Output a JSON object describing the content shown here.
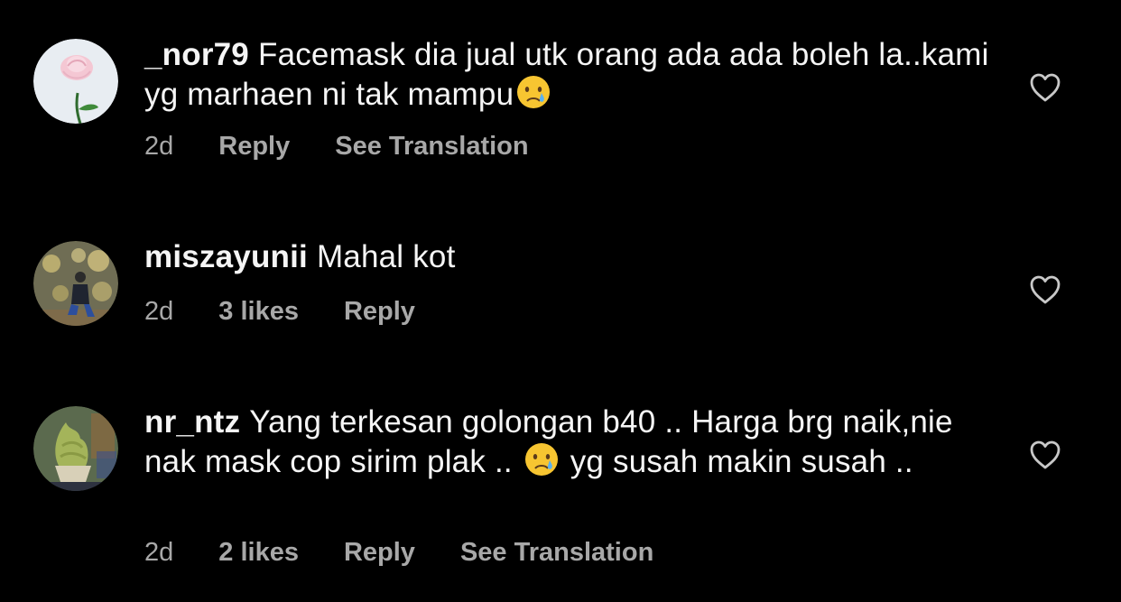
{
  "comments": [
    {
      "username": "_nor79",
      "text_parts": [
        "Facemask dia jual utk orang ada ada boleh la..kami yg marhaen ni tak mampu"
      ],
      "time": "2d",
      "likes": "",
      "reply": "Reply",
      "translate": "See Translation",
      "avatar_icon": "rose-avatar",
      "emoji": "crying-face"
    },
    {
      "username": "miszayunii",
      "text_parts": [
        "Mahal kot"
      ],
      "time": "2d",
      "likes": "3 likes",
      "reply": "Reply",
      "translate": "",
      "avatar_icon": "person-lights-avatar"
    },
    {
      "username": "nr_ntz",
      "text_parts": [
        "Yang terkesan golongan b40 .. Harga brg naik,nie nak mask cop sirim plak ..",
        "yg susah makin susah .."
      ],
      "time": "2d",
      "likes": "2 likes",
      "reply": "Reply",
      "translate": "See Translation",
      "avatar_icon": "ice-cream-avatar",
      "emoji": "crying-face"
    }
  ],
  "colors": {
    "background": "#000000",
    "text": "#f5f5f5",
    "meta": "#a8a8a8"
  },
  "icons": {
    "like": "heart-outline-icon"
  }
}
